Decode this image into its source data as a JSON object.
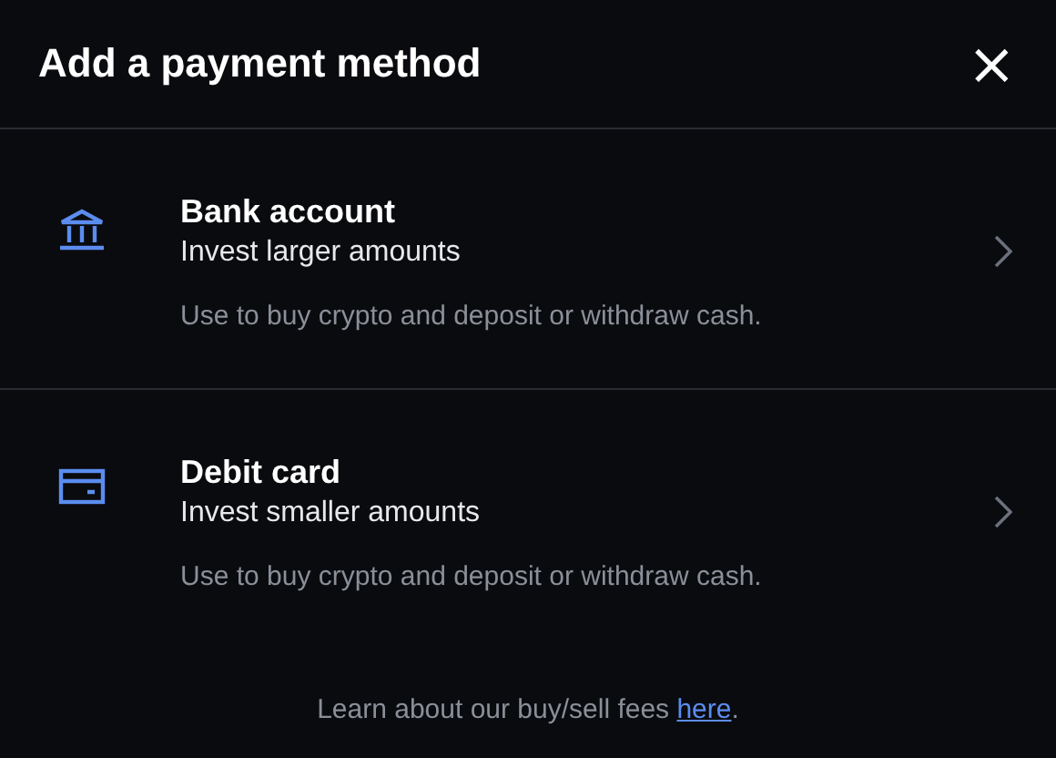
{
  "dialog": {
    "title": "Add a payment method",
    "close": "×"
  },
  "methods": [
    {
      "kind": "bank",
      "title": "Bank account",
      "subtitle": "Invest larger amounts",
      "description": "Use to buy crypto and deposit or withdraw cash."
    },
    {
      "kind": "card",
      "title": "Debit card",
      "subtitle": "Invest smaller amounts",
      "description": "Use to buy crypto and deposit or withdraw cash."
    }
  ],
  "footer": {
    "text": "Learn about our buy/sell fees ",
    "link": "here",
    "after": "."
  }
}
